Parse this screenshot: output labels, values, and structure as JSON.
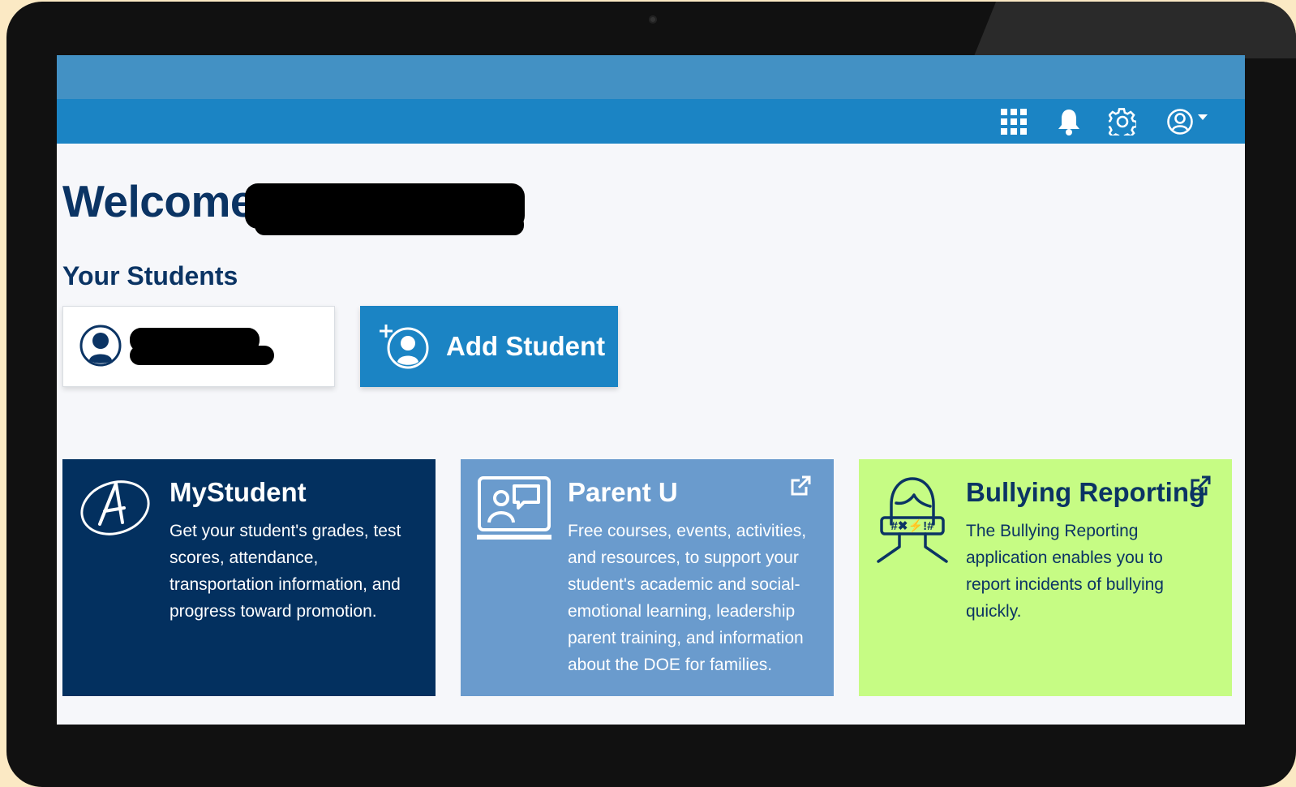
{
  "header": {
    "icons": [
      "apps-grid-icon",
      "bell-icon",
      "gear-icon",
      "user-circle-icon",
      "caret-down-icon"
    ]
  },
  "welcome": {
    "text": "Welcome,"
  },
  "students": {
    "heading": "Your Students",
    "add_label": "Add Student"
  },
  "tiles": [
    {
      "title": "MyStudent",
      "description": "Get your student's grades, test scores, attendance, transportation information, and progress toward promotion.",
      "icon": "mystudent-logo-icon",
      "color": "#03305f"
    },
    {
      "title": "Parent U",
      "description": "Free courses, events, activities, and resources, to support your student's academic and social-emotional learning, leadership parent training, and information about the DOE for families.",
      "icon": "online-class-icon",
      "color": "#6a9bcd"
    },
    {
      "title": "Bullying Reporting",
      "description": "The Bullying Reporting application enables you to report incidents of bullying quickly.",
      "icon": "bullying-reporting-icon",
      "color": "#c6fc84"
    }
  ],
  "colors": {
    "primary": "#1b84c4",
    "navy": "#0b3464",
    "topbar_light": "#4391c4"
  }
}
